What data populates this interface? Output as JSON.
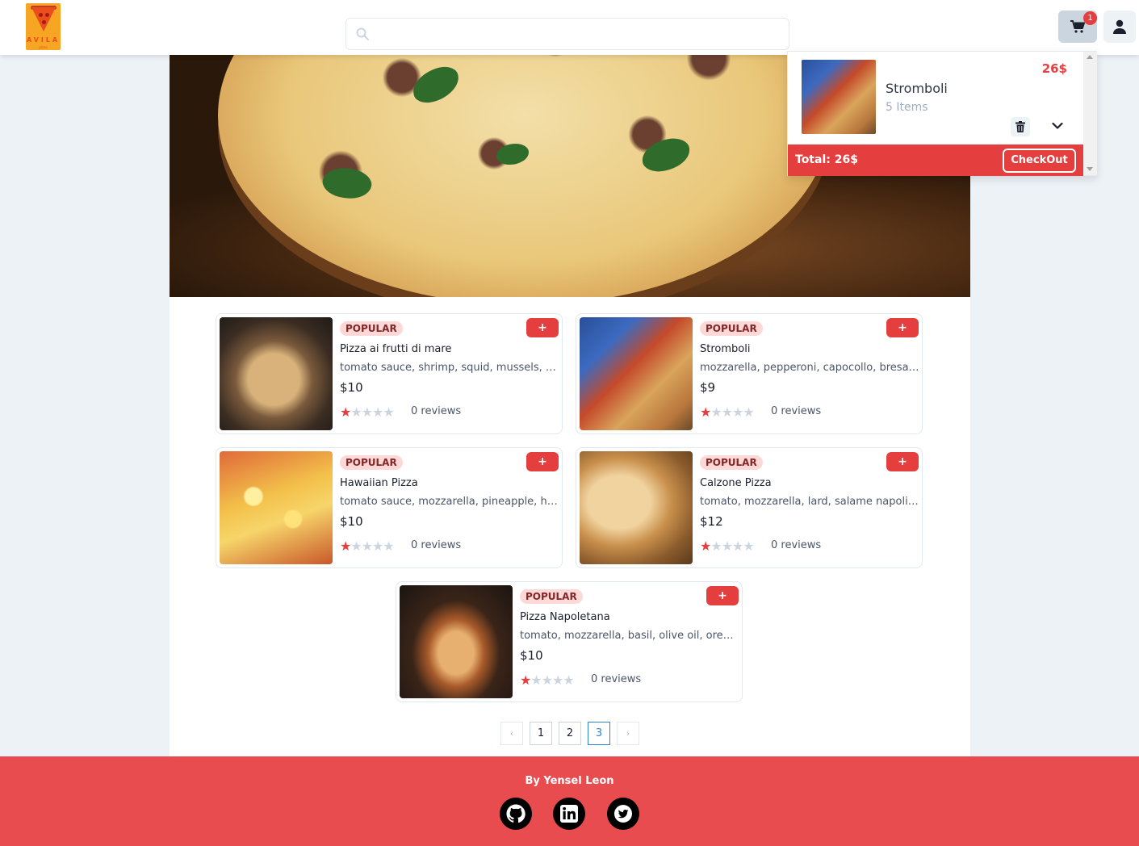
{
  "header": {
    "logo_text": "AVILA",
    "logo_sub": "pizza",
    "search": {
      "placeholder": "",
      "value": ""
    },
    "cart_badge": "1"
  },
  "cart": {
    "items": [
      {
        "name": "Stromboli",
        "qty": "5 Items",
        "price": "26$"
      }
    ],
    "total": "Total: 26$",
    "checkout_label": "CheckOut"
  },
  "products": [
    {
      "badge": "POPULAR",
      "add": "+",
      "name": "Pizza ai frutti di mare",
      "desc": "tomato sauce, shrimp, squid, mussels, olive oil",
      "price": "$10",
      "rating": 1,
      "reviews": "0 reviews"
    },
    {
      "badge": "POPULAR",
      "add": "+",
      "name": "Stromboli",
      "desc": "mozzarella, pepperoni, capocollo, bresaola, ham",
      "price": "$9",
      "rating": 1,
      "reviews": "0 reviews"
    },
    {
      "badge": "POPULAR",
      "add": "+",
      "name": "Hawaiian Pizza",
      "desc": "tomato sauce, mozzarella, pineapple, ham",
      "price": "$10",
      "rating": 1,
      "reviews": "0 reviews"
    },
    {
      "badge": "POPULAR",
      "add": "+",
      "name": "Calzone Pizza",
      "desc": "tomato, mozzarella, lard, salame napoli, pepper",
      "price": "$12",
      "rating": 1,
      "reviews": "0 reviews"
    },
    {
      "badge": "POPULAR",
      "add": "+",
      "name": "Pizza Napoletana",
      "desc": "tomato, mozzarella, basil, olive oil, oregano",
      "price": "$10",
      "rating": 1,
      "reviews": "0 reviews"
    }
  ],
  "pagination": {
    "prev": "‹",
    "pages": [
      "1",
      "2",
      "3"
    ],
    "current": "3",
    "next": "›"
  },
  "footer": {
    "by": "By Yensel Leon",
    "social": [
      "github-icon",
      "linkedin-icon",
      "twitter-icon"
    ]
  },
  "colors": {
    "accent": "#e53e3e",
    "footer": "#e84c4f",
    "badge_bg": "#fed7d7"
  }
}
